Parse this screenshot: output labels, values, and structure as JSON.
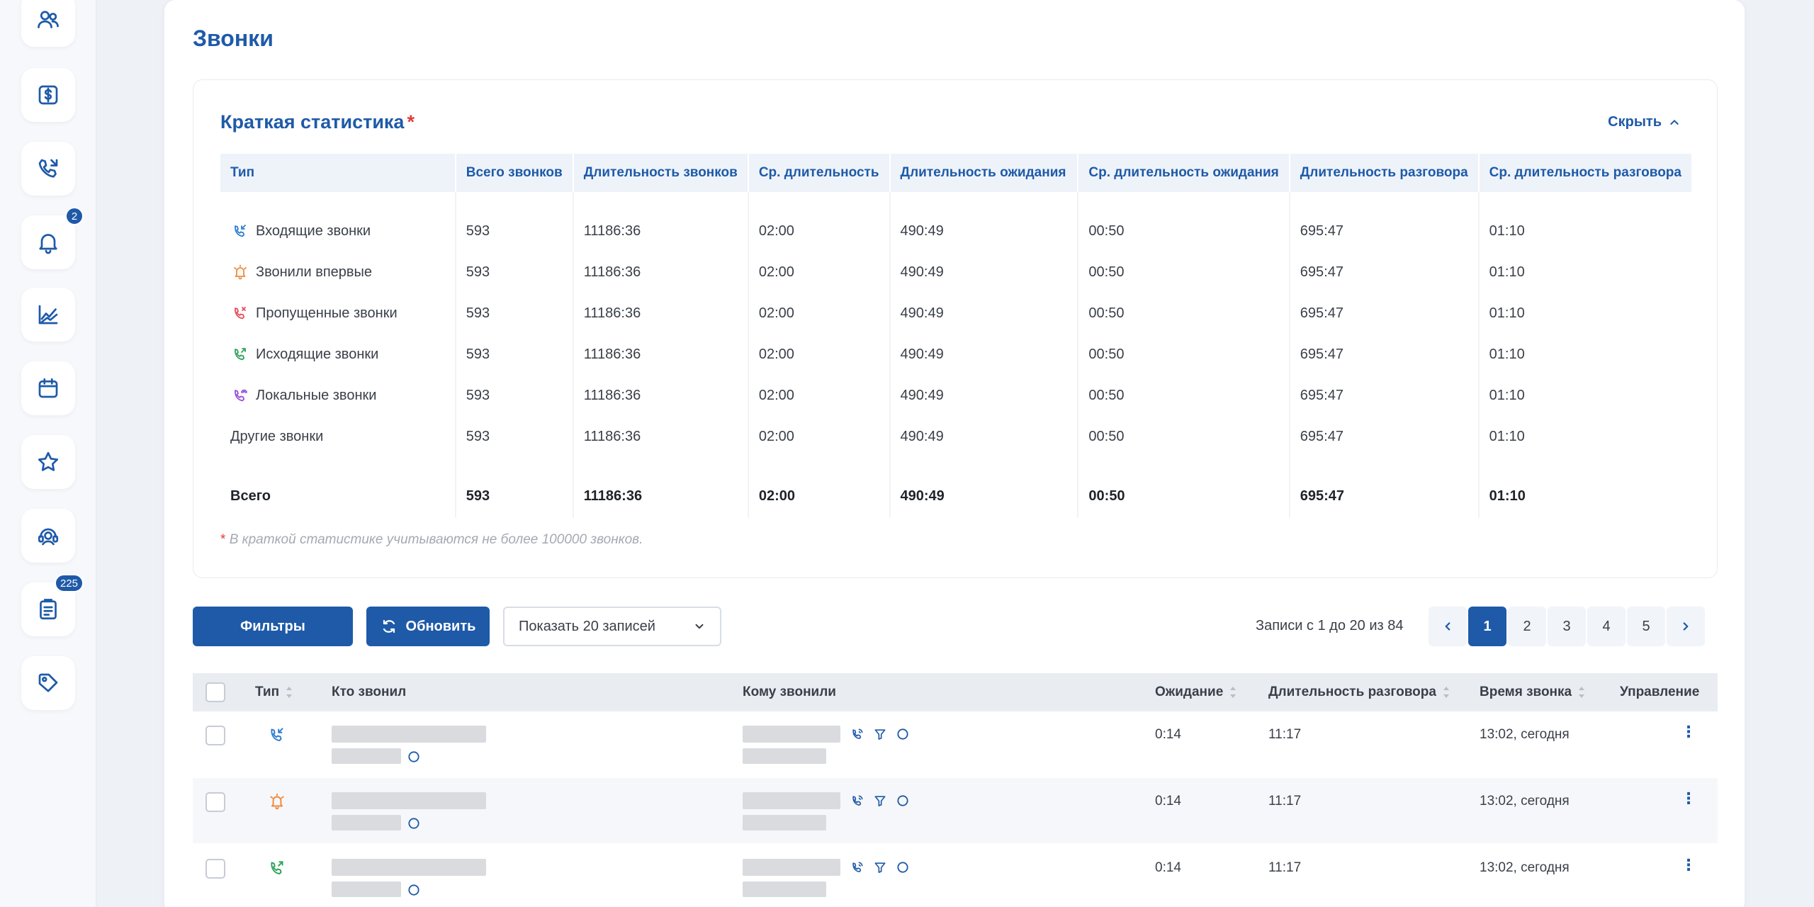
{
  "sidebar": {
    "items": [
      {
        "icon": "users-icon"
      },
      {
        "icon": "dollar-icon"
      },
      {
        "icon": "phone-calls-icon"
      },
      {
        "icon": "bell-icon",
        "badge": "2"
      },
      {
        "icon": "chart-line-icon"
      },
      {
        "icon": "calendar-icon"
      },
      {
        "icon": "star-icon"
      },
      {
        "icon": "operator-headset-icon"
      },
      {
        "icon": "clipboard-icon",
        "badge": "225"
      },
      {
        "icon": "tag-icon"
      }
    ]
  },
  "page": {
    "title": "Звонки"
  },
  "stats": {
    "title": "Краткая статистика",
    "star": "*",
    "hide_label": "Скрыть",
    "headers": [
      "Тип",
      "Всего звонков",
      "Длительность звонков",
      "Ср. длительность",
      "Длительность ожидания",
      "Ср. длительность ожидания",
      "Длительность разговора",
      "Ср. длительность разговора"
    ],
    "rows": [
      {
        "type": "Входящие звонки",
        "icon": "incoming-call-icon",
        "total": "593",
        "duration": "11186:36",
        "avg_duration": "02:00",
        "wait": "490:49",
        "avg_wait": "00:50",
        "talk": "695:47",
        "avg_talk": "01:10"
      },
      {
        "type": "Звонили впервые",
        "icon": "first-call-bell-icon",
        "total": "593",
        "duration": "11186:36",
        "avg_duration": "02:00",
        "wait": "490:49",
        "avg_wait": "00:50",
        "talk": "695:47",
        "avg_talk": "01:10"
      },
      {
        "type": "Пропущенные звонки",
        "icon": "missed-call-icon",
        "total": "593",
        "duration": "11186:36",
        "avg_duration": "02:00",
        "wait": "490:49",
        "avg_wait": "00:50",
        "talk": "695:47",
        "avg_talk": "01:10"
      },
      {
        "type": "Исходящие звонки",
        "icon": "outgoing-call-icon",
        "total": "593",
        "duration": "11186:36",
        "avg_duration": "02:00",
        "wait": "490:49",
        "avg_wait": "00:50",
        "talk": "695:47",
        "avg_talk": "01:10"
      },
      {
        "type": "Локальные звонки",
        "icon": "local-call-icon",
        "total": "593",
        "duration": "11186:36",
        "avg_duration": "02:00",
        "wait": "490:49",
        "avg_wait": "00:50",
        "talk": "695:47",
        "avg_talk": "01:10"
      },
      {
        "type": "Другие звонки",
        "icon": "",
        "total": "593",
        "duration": "11186:36",
        "avg_duration": "02:00",
        "wait": "490:49",
        "avg_wait": "00:50",
        "talk": "695:47",
        "avg_talk": "01:10"
      }
    ],
    "total_row": {
      "type": "Всего",
      "total": "593",
      "duration": "11186:36",
      "avg_duration": "02:00",
      "wait": "490:49",
      "avg_wait": "00:50",
      "talk": "695:47",
      "avg_talk": "01:10"
    },
    "note": "В краткой статистике учитываются не более 100000 звонков."
  },
  "toolbar": {
    "filters_label": "Фильтры",
    "refresh_label": "Обновить",
    "page_size_value": "Показать 20 записей",
    "records_info": "Записи с 1 до 20 из 84",
    "pages": [
      "1",
      "2",
      "3",
      "4",
      "5"
    ],
    "active_page": "1"
  },
  "calls": {
    "headers": {
      "type": "Тип",
      "caller": "Кто звонил",
      "callee": "Кому звонили",
      "wait": "Ожидание",
      "talk": "Длительность разговора",
      "time": "Время звонка",
      "actions": "Управление"
    },
    "rows": [
      {
        "type_icon": "incoming-call-icon",
        "wait": "0:14",
        "talk": "11:17",
        "time": "13:02, сегодня"
      },
      {
        "type_icon": "first-call-bell-icon",
        "wait": "0:14",
        "talk": "11:17",
        "time": "13:02, сегодня"
      },
      {
        "type_icon": "outgoing-call-icon",
        "wait": "0:14",
        "talk": "11:17",
        "time": "13:02, сегодня"
      }
    ]
  },
  "colors": {
    "accent": "#1e5aa8",
    "required_star": "#e23b3b",
    "incoming": "#2f7fd1",
    "first_call": "#f08a3c",
    "missed": "#e84b5a",
    "outgoing": "#2fa35a",
    "local": "#9b4fd6"
  }
}
